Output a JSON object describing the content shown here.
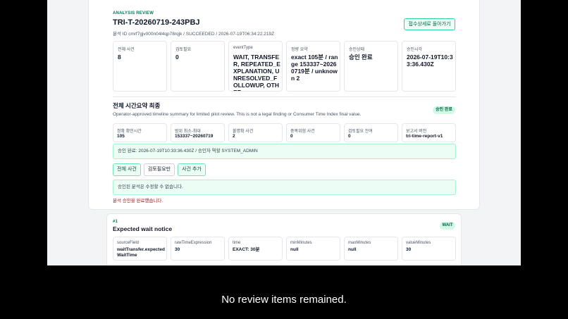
{
  "review": {
    "kicker": "ANALYSIS REVIEW",
    "title": "TRI-T-20260719-243PBJ",
    "meta": "분석 ID cmrf7gjv000n04l4qp78rqjk / SUCCEEDED / 2026-07-19T06:34:22.219Z",
    "back_label": "접수상세로 돌아가기",
    "stats": [
      {
        "label": "전체 사건",
        "value": "8"
      },
      {
        "label": "검토필요",
        "value": "0"
      },
      {
        "label": "eventType",
        "value": "WAIT, TRANSFER, REPEATED_EXPLANATION, UNRESOLVED_FOLLOWUP, OTHER"
      },
      {
        "label": "정량 요약",
        "value": "exact 105분 / range 153337~20260719분 / unknown 2"
      },
      {
        "label": "승인상태",
        "value": "승인 완료"
      },
      {
        "label": "승인시각",
        "value": "2026-07-19T10:33:36.430Z"
      }
    ]
  },
  "summary": {
    "heading": "전체 시간요약 최종",
    "description": "Operator-approved timeline summary for limited pilot review. This is not a legal finding or Consumer Time Index final value.",
    "badge": "승인 완료",
    "cells": [
      {
        "label": "정확 확인시간",
        "value": "105"
      },
      {
        "label": "범위 최소-최대",
        "value": "153337~20260719"
      },
      {
        "label": "불명확 사건",
        "value": "2"
      },
      {
        "label": "중복위험 사건",
        "value": "0"
      },
      {
        "label": "검토필요 잔여",
        "value": "0"
      },
      {
        "label": "보고서 버전",
        "value": "tri-time-report-v1"
      }
    ],
    "approval_notice": "승인 완료: 2026-07-19T10:33:36.430Z / 승인자 역할 SYSTEM_ADMIN",
    "tabs": [
      {
        "label": "전체 사건"
      },
      {
        "label": "검토필요만"
      },
      {
        "label": "사건 추가"
      }
    ],
    "locked_notice": "승인된 분석은 수정할 수 없습니다.",
    "status_message": "분석 승인을 완료했습니다."
  },
  "event": {
    "index": "#1",
    "title": "Expected wait notice",
    "badge": "WAIT",
    "fields": [
      {
        "label": "sourceField",
        "value": "waitTransfer.expectedWaitTime"
      },
      {
        "label": "rawTimeExpression",
        "value": "30"
      },
      {
        "label": "time",
        "value": "EXACT: 30분"
      },
      {
        "label": "minMinutes",
        "value": "null"
      },
      {
        "label": "maxMinutes",
        "value": "null"
      },
      {
        "label": "valueMinutes",
        "value": "30"
      }
    ]
  },
  "caption": "No review items remained."
}
